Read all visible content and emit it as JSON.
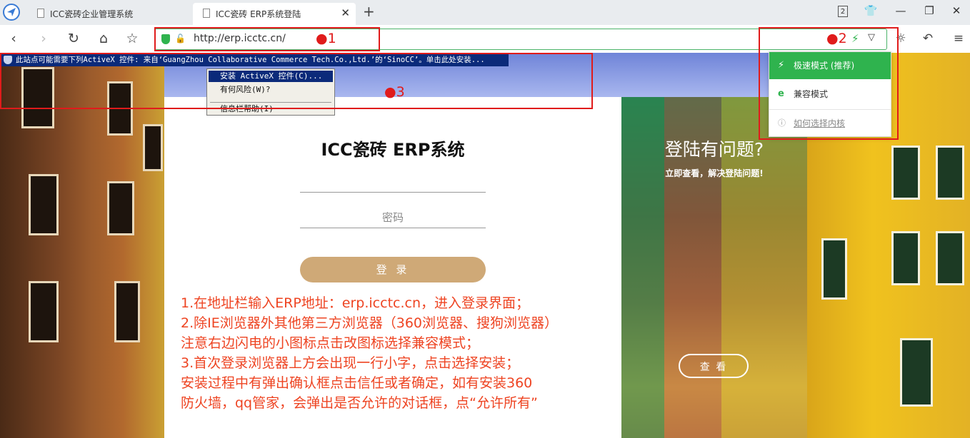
{
  "tabs": [
    {
      "title": "ICC瓷砖企业管理系统",
      "active": false
    },
    {
      "title": "ICC瓷砖 ERP系统登陆",
      "active": true
    }
  ],
  "window": {
    "tab_count_badge": "2"
  },
  "address_bar": {
    "url": "http://erp.icctc.cn/"
  },
  "infobar": {
    "text": "此站点可能需要下列ActiveX 控件: 来自‘GuangZhou Collaborative Commerce Tech.Co.,Ltd.’的‘SinoCC’。单击此处安装..."
  },
  "context_menu": {
    "items": [
      "安装 ActiveX 控件(C)...",
      "有何风险(W)?",
      "信息栏帮助(I)"
    ]
  },
  "kernel_menu": {
    "speed_mode": "极速模式 (推荐)",
    "compat_mode": "兼容模式",
    "help_link": "如何选择内核"
  },
  "login": {
    "title": "ICC瓷砖 ERP系统",
    "password_placeholder": "密码",
    "login_button": "登 录"
  },
  "help_panel": {
    "title": "登陆有问题?",
    "subtitle": "立即查看，解决登陆问题!",
    "view_button": "查 看"
  },
  "instructions": [
    "1.在地址栏输入ERP地址：erp.icctc.cn，进入登录界面；",
    "2.除IE浏览器外其他第三方浏览器（360浏览器、搜狗浏览器）",
    "   注意右边闪电的小图标点击改图标选择兼容模式；",
    "3.首次登录浏览器上方会出现一行小字，点击选择安装；",
    "   安装过程中有弹出确认框点击信任或者确定，如有安装360",
    "   防火墙，qq管家，会弹出是否允许的对话框，点“允许所有”"
  ],
  "annotations": {
    "marker1": "●1",
    "marker2": "●2",
    "marker3": "●3"
  },
  "colors": {
    "accent_green": "#2fb34e",
    "annotation_red": "#e01b1b",
    "login_button": "#cfa977",
    "infobar_blue": "#0b2a7a"
  }
}
